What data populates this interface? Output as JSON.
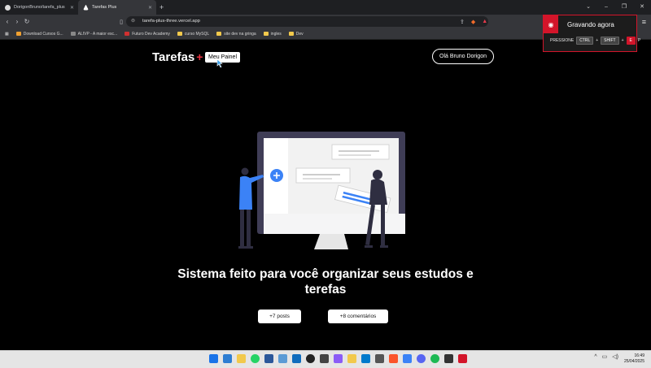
{
  "browser": {
    "tabs": [
      {
        "label": "DorigonBruno/tarefa_plus",
        "active": false
      },
      {
        "label": "Tarefas Plus",
        "active": true
      }
    ],
    "url": "tarefa-plus-three.vercel.app",
    "bookmarks": [
      {
        "label": "Download Cursos G...",
        "color": "#f0a030"
      },
      {
        "label": "ALIVP - A maior esc...",
        "color": "#222222"
      },
      {
        "label": "Futuro Dev Academy",
        "color": "#d03030"
      },
      {
        "label": "curso MySQL",
        "color": "#f2c94c"
      },
      {
        "label": "site dev na gringa",
        "color": "#f2c94c"
      },
      {
        "label": "ingles",
        "color": "#f2c94c"
      },
      {
        "label": "Dev",
        "color": "#f2c94c"
      }
    ]
  },
  "recording": {
    "title": "Gravando agora",
    "press": "PRESSIONE",
    "keys": [
      "CTRL",
      "SHIFT",
      "E"
    ],
    "trailing": "P"
  },
  "header": {
    "logo_text": "Tarefas",
    "logo_plus": "+",
    "painel_label": "Meu Painel",
    "greeting": "Olá Bruno Dorigon"
  },
  "main": {
    "headline": "Sistema feito para você organizar seus estudos e terefas",
    "posts_label": "+7 posts",
    "comments_label": "+8 comentários"
  },
  "taskbar": {
    "time": "16:49",
    "date": "25/04/2025"
  },
  "colors": {
    "accent": "#ea3140",
    "record_red": "#d3152a",
    "illustration_blue": "#3b82f6"
  }
}
